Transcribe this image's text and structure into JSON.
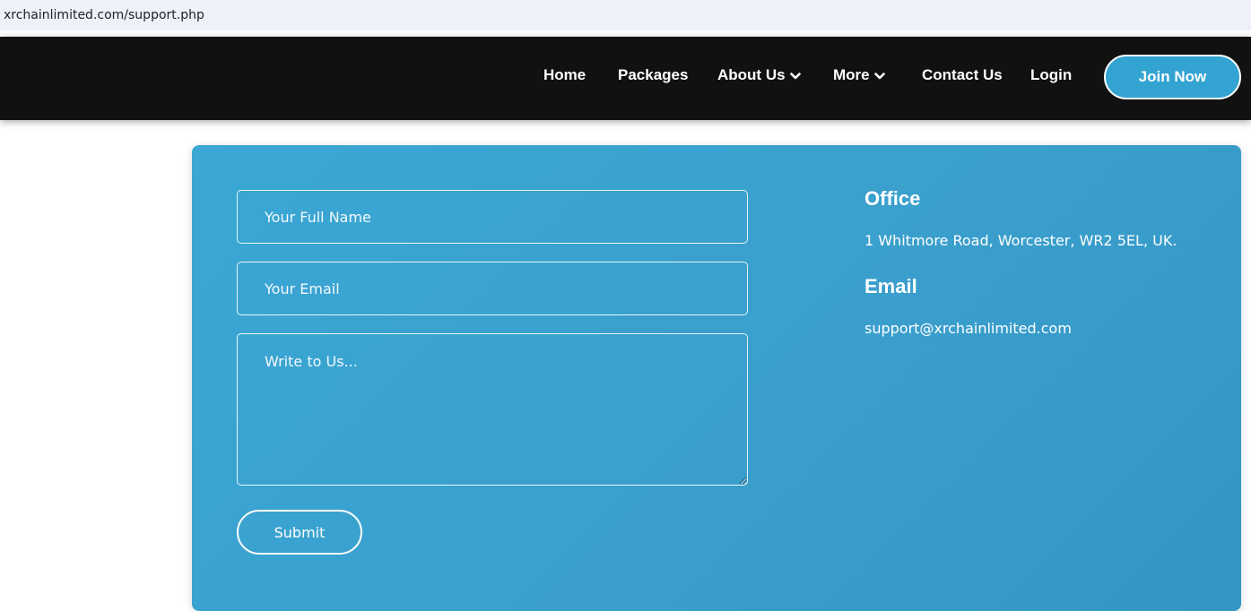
{
  "browser": {
    "url": "xrchainlimited.com/support.php"
  },
  "nav": {
    "items": [
      {
        "label": "Home"
      },
      {
        "label": "Packages"
      },
      {
        "label": "About Us",
        "icon": "chevron-down-icon"
      },
      {
        "label": "More",
        "icon": "chevron-down-icon"
      },
      {
        "label": "Contact Us"
      },
      {
        "label": "Login"
      }
    ],
    "join_label": "Join Now"
  },
  "form": {
    "name_placeholder": "Your Full Name",
    "email_placeholder": "Your Email",
    "message_placeholder": "Write to Us...",
    "submit_label": "Submit"
  },
  "contact": {
    "office_heading": "Office",
    "office_address": "1 Whitmore Road, Worcester, WR2 5EL, UK.",
    "email_heading": "Email",
    "email_address": "support@xrchainlimited.com"
  },
  "colors": {
    "header_bg": "#111111",
    "accent": "#33a4d1",
    "card_bg": "#3aa2d0"
  }
}
